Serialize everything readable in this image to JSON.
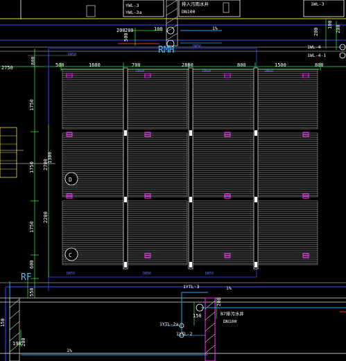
{
  "drawing": {
    "colors": {
      "background": "#000000",
      "grid_line": "#e0e0e0",
      "dim_line": "#27e03a",
      "pipe_blue": "#3a4dff",
      "pipe_cyan": "#22a8ff",
      "magenta": "#ff2cff",
      "red": "#ff2a2a",
      "yellow": "#f0e030",
      "wall_hatch": "#c8c8c8"
    },
    "top_labels": {
      "dim_2750": "2750",
      "dim_500": "500",
      "dim_1600": "1600",
      "dim_700": "700",
      "dim_2800": "2800",
      "dim_800": "800",
      "dim_1500": "1500",
      "dim_800b": "800",
      "v_800": "800",
      "h_200_a": "200",
      "h_200_b": "200",
      "h_500": "500",
      "h_100": "100",
      "h_200_c": "200",
      "h_200_d": "200",
      "h_100_r": "100"
    },
    "pipe_tags": {
      "ywl3": "YWL-3",
      "ywl3a": "YWL-3a",
      "dn100_top": "DN100",
      "tag_top_text": "排入污雨水井",
      "ywl_r": "1WL-3",
      "ywl4": "1WL-4",
      "ywl41": "1WL-4-1",
      "rmh": "RMH",
      "dn50": "DN50",
      "pct_1": "1%",
      "pct_2": "1%",
      "pct_3": "1%"
    },
    "left_dims": {
      "v_1750_a": "1750",
      "v_1300": "1300",
      "v_1750_b": "1750",
      "v_2200": "2200",
      "v_600": "600",
      "v_550": "550",
      "v_2700": "2700",
      "v_1750_label": "1750"
    },
    "axes": {
      "D": "D",
      "C": "C"
    },
    "bottom_labels": {
      "rf": "RF",
      "ytl3": "1YTL-3",
      "ytl2a": "1YTL-2a",
      "ytl2": "1YTL-2",
      "dim_150": "150",
      "dim_200": "200",
      "dim_200b": "200",
      "dim_190": "190",
      "dim_150b": "150",
      "tag_bottom": "B7排污水井",
      "dn100_bottom": "DN100",
      "pct_bottom": "1%"
    }
  }
}
